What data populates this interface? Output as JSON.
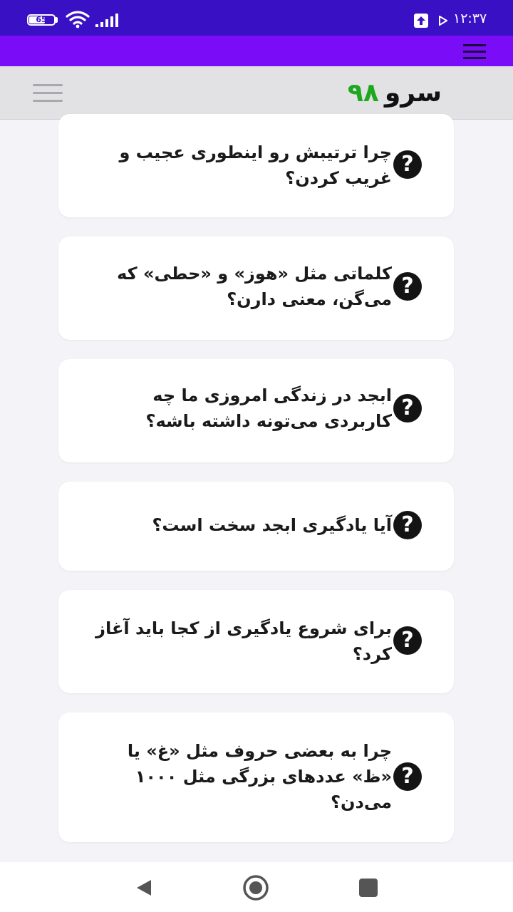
{
  "status_bar": {
    "battery_level": "65",
    "time": "۱۲:۳۷",
    "background_color": "#3a10c4"
  },
  "top_bar": {
    "background_color": "#7a0cf7",
    "menu_icon": "hamburger-menu-icon"
  },
  "header": {
    "brand_text": "سرو",
    "brand_number": "۹۸",
    "brand_number_color": "#1ea81e",
    "menu_icon": "hamburger-menu-icon"
  },
  "faq": {
    "icon_glyph": "?",
    "items": [
      {
        "question": "چرا ترتیبش رو اینطوری عجیب و غریب کردن؟"
      },
      {
        "question": "کلماتی مثل «هوز» و «حطی» که می‌گن، معنی دارن؟"
      },
      {
        "question": "ابجد در زندگی امروزی ما چه کاربردی می‌تونه داشته باشه؟"
      },
      {
        "question": "آیا یادگیری ابجد سخت است؟"
      },
      {
        "question": "برای شروع یادگیری از کجا باید آغاز کرد؟"
      },
      {
        "question": "چرا به بعضی حروف مثل «غ» یا «ظ» عددهای بزرگی مثل ۱۰۰۰ می‌دن؟"
      }
    ]
  },
  "nav": {
    "back_icon": "back-triangle-icon",
    "home_icon": "home-circle-icon",
    "recents_icon": "recents-square-icon"
  }
}
